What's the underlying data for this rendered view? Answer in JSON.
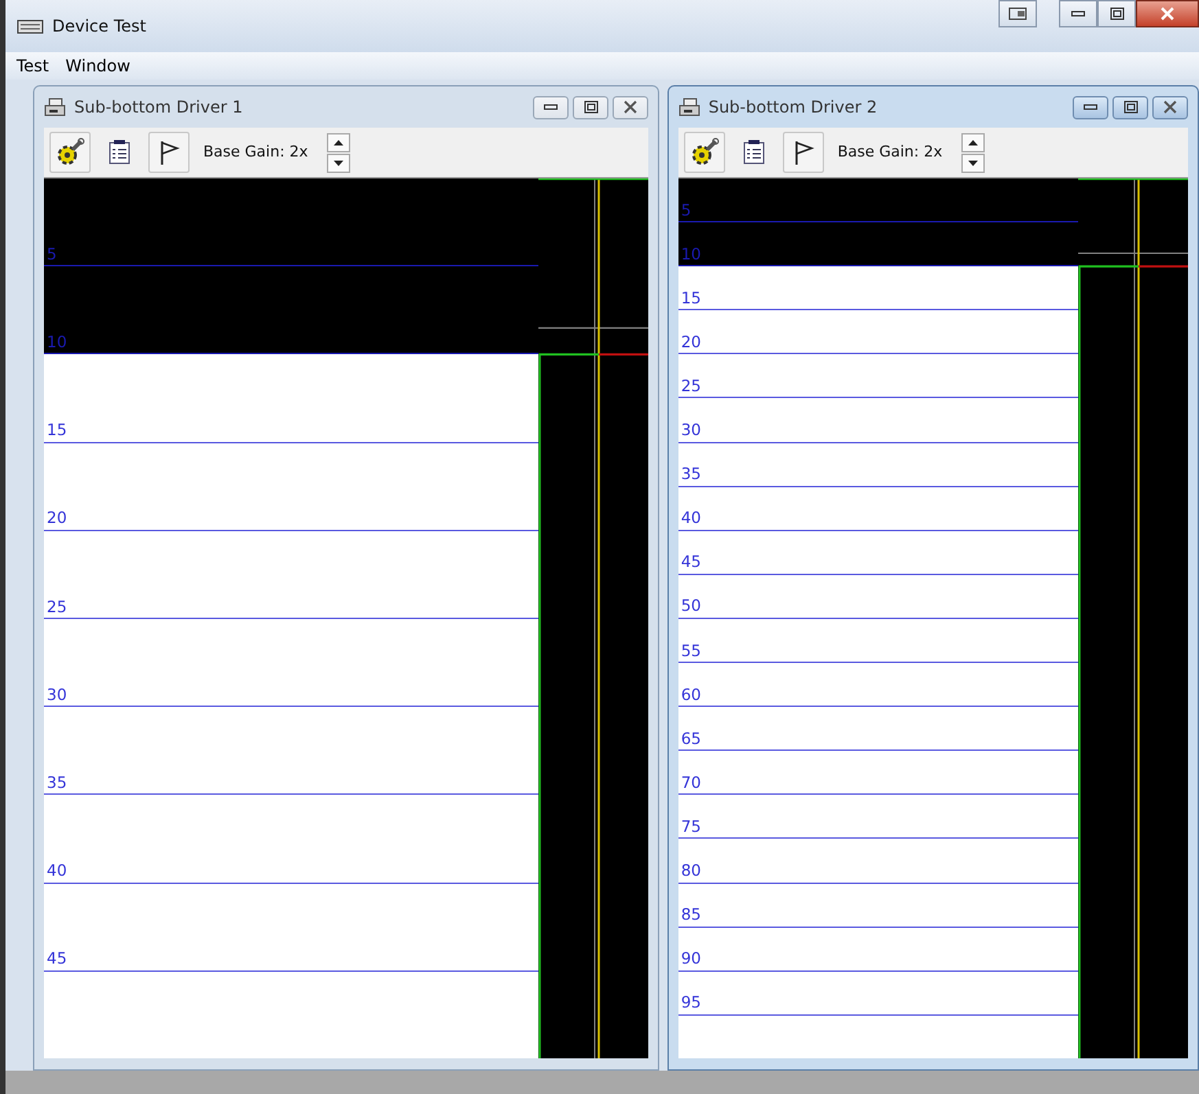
{
  "window": {
    "title": "Device Test"
  },
  "menu": [
    {
      "label": "Test"
    },
    {
      "label": "Window"
    }
  ],
  "child_windows": [
    {
      "title": "Sub-bottom Driver 1",
      "active": false,
      "gain": "Base Gain: 2x",
      "depth_marks": [
        {
          "label": "5",
          "dark": true
        },
        {
          "label": "10",
          "dark": true
        },
        {
          "label": "15",
          "dark": false
        },
        {
          "label": "20",
          "dark": false
        },
        {
          "label": "25",
          "dark": false
        },
        {
          "label": "30",
          "dark": false
        },
        {
          "label": "35",
          "dark": false
        },
        {
          "label": "40",
          "dark": false
        },
        {
          "label": "45",
          "dark": false
        }
      ]
    },
    {
      "title": "Sub-bottom Driver 2",
      "active": true,
      "gain": "Base Gain: 2x",
      "depth_marks": [
        {
          "label": "5",
          "dark": true
        },
        {
          "label": "10",
          "dark": true
        },
        {
          "label": "15",
          "dark": false
        },
        {
          "label": "20",
          "dark": false
        },
        {
          "label": "25",
          "dark": false
        },
        {
          "label": "30",
          "dark": false
        },
        {
          "label": "35",
          "dark": false
        },
        {
          "label": "40",
          "dark": false
        },
        {
          "label": "45",
          "dark": false
        },
        {
          "label": "50",
          "dark": false
        },
        {
          "label": "55",
          "dark": false
        },
        {
          "label": "60",
          "dark": false
        },
        {
          "label": "65",
          "dark": false
        },
        {
          "label": "70",
          "dark": false
        },
        {
          "label": "75",
          "dark": false
        },
        {
          "label": "80",
          "dark": false
        },
        {
          "label": "85",
          "dark": false
        },
        {
          "label": "90",
          "dark": false
        },
        {
          "label": "95",
          "dark": false
        }
      ]
    }
  ]
}
